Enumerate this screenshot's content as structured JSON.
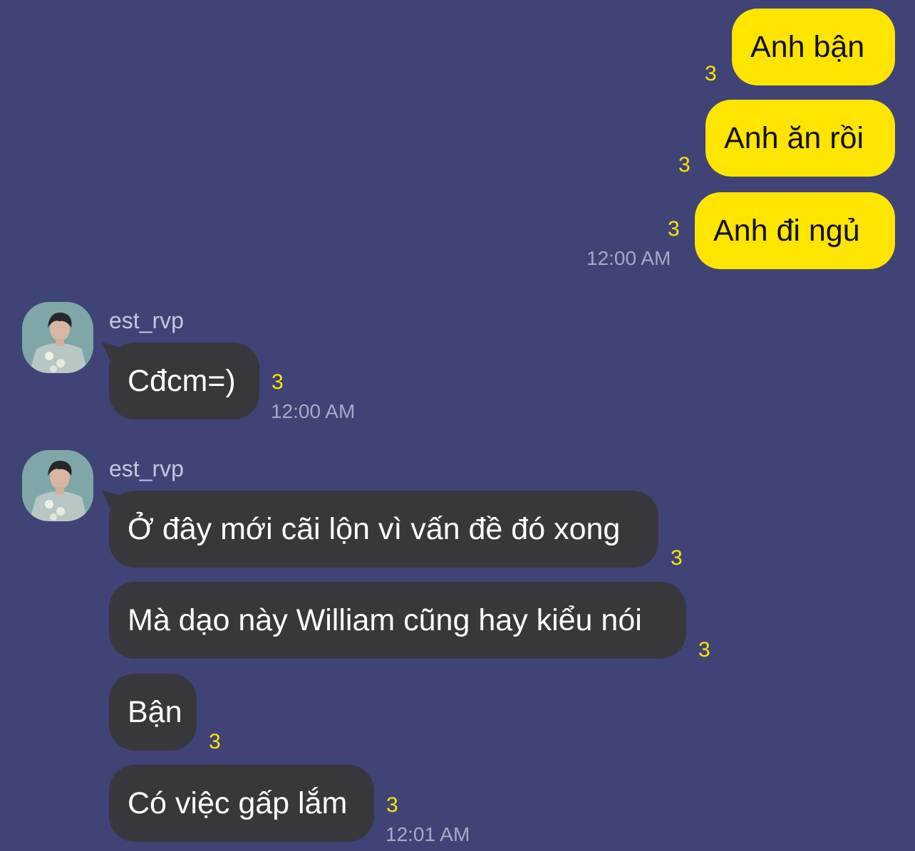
{
  "colors": {
    "background": "#404375",
    "my_bubble": "#fee500",
    "their_bubble": "#38373c",
    "unread_count": "#fee500",
    "timestamp": "#a7a9c6"
  },
  "outgoing": {
    "messages": [
      {
        "text": "Anh bận",
        "unread": "3"
      },
      {
        "text": "Anh ăn rồi",
        "unread": "3"
      },
      {
        "text": "Anh đi ngủ",
        "unread": "3"
      }
    ],
    "time": "12:00 AM"
  },
  "incoming_group_1": {
    "sender": "est_rvp",
    "avatar_icon": "profile-photo",
    "messages": [
      {
        "text": "Cđcm=)",
        "unread": "3"
      }
    ],
    "time": "12:00 AM"
  },
  "incoming_group_2": {
    "sender": "est_rvp",
    "avatar_icon": "profile-photo",
    "messages": [
      {
        "text": "Ở đây mới cãi lộn vì vấn đề đó xong",
        "unread": "3"
      },
      {
        "text": "Mà dạo này William cũng hay kiểu nói",
        "unread": "3"
      },
      {
        "text": "Bận",
        "unread": "3"
      },
      {
        "text": "Có việc gấp lắm",
        "unread": "3"
      }
    ],
    "time": "12:01 AM"
  }
}
